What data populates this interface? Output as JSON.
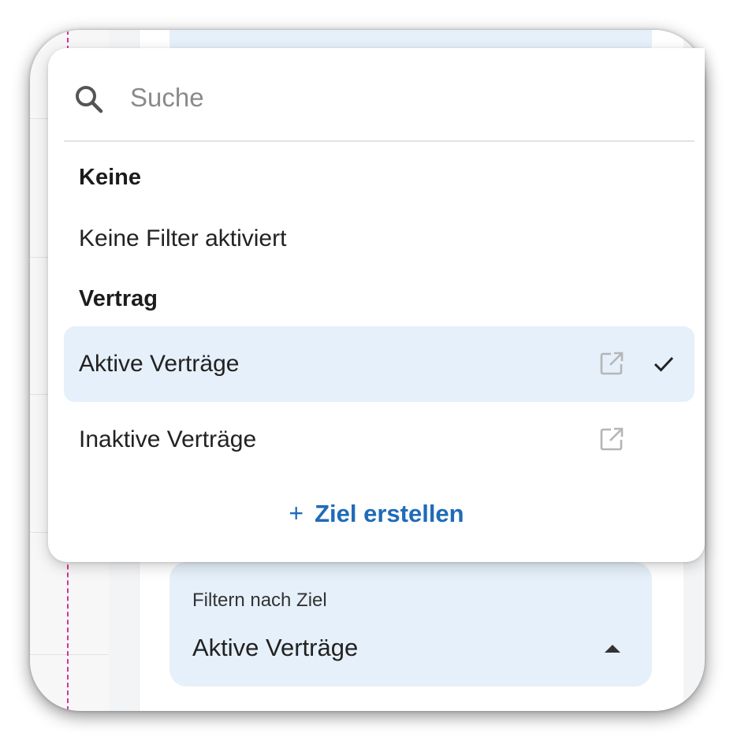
{
  "search": {
    "placeholder": "Suche"
  },
  "groups": [
    {
      "header": "Keine",
      "options": [
        {
          "label": "Keine Filter aktiviert"
        }
      ]
    },
    {
      "header": "Vertrag",
      "options": [
        {
          "label": "Aktive Verträge",
          "selected": true
        },
        {
          "label": "Inaktive Verträge",
          "selected": false
        }
      ]
    }
  ],
  "create": {
    "plus": "+",
    "label": "Ziel erstellen"
  },
  "filter": {
    "label": "Filtern nach Ziel",
    "value": "Aktive Verträge"
  },
  "colors": {
    "accent": "#1f6bb8",
    "selected_background": "#e6f0fa",
    "guide_line": "#d6349a"
  },
  "icons": [
    "search-icon",
    "open-in-new-icon",
    "check-icon",
    "caret-up-icon"
  ]
}
